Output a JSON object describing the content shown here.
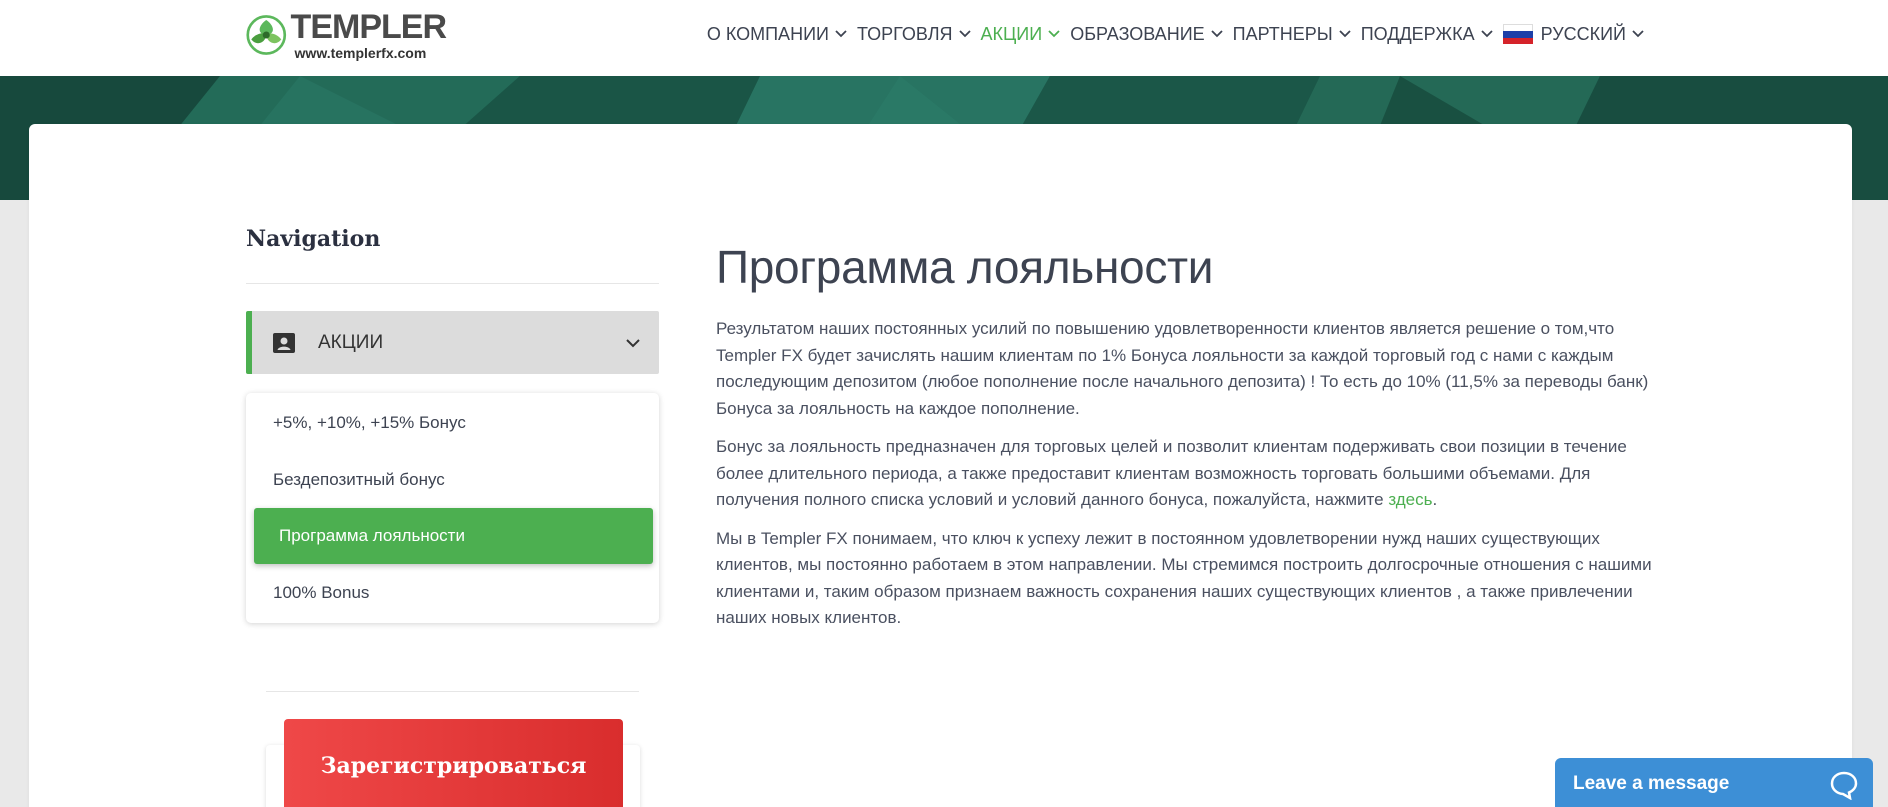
{
  "header": {
    "logo_name": "TEMPLER",
    "logo_url": "www.templerfx.com",
    "nav": [
      {
        "label": "О КОМПАНИИ",
        "active": false
      },
      {
        "label": "ТОРГОВЛЯ",
        "active": false
      },
      {
        "label": "АКЦИИ",
        "active": true
      },
      {
        "label": "ОБРАЗОВАНИЕ",
        "active": false
      },
      {
        "label": "ПАРТНЕРЫ",
        "active": false
      },
      {
        "label": "ПОДДЕРЖКА",
        "active": false
      }
    ],
    "language": "РУССКИЙ"
  },
  "sidebar": {
    "title": "Navigation",
    "accordion_label": "АКЦИИ",
    "items": [
      {
        "label": "+5%, +10%, +15% Бонус"
      },
      {
        "label": "Бездепозитный бонус"
      },
      {
        "label": "Программа лояльности"
      },
      {
        "label": "100% Bonus"
      }
    ],
    "register_label": "Зарегистрироваться"
  },
  "main": {
    "title": "Программа лояльности",
    "paragraphs": [
      "Результатом наших постоянных усилий по повышению удовлетворенности клиентов является решение о том,что Templer FX будет зачислять нашим клиентам по 1% Бонуса лояльности за каждой торговый год с нами с каждым последующим депозитом (любое пополнение после начального депозита) ! То есть до 10% (11,5% за переводы банк) Бонуса за лояльность на каждое пополнение.",
      "Бонус за лояльность предназначен для торговых целей и позволит клиентам подерживать свои позиции в течение более длительного периода, а также предоставит клиентам возможность торговать большими объемами. Для получения полного списка условий и условий данного бонуса, пожалуйста, нажмите",
      "Мы в Templer FX понимаем, что ключ к успеху лежит в постоянном удовлетворении нужд наших существующих клиентов, мы постоянно работаем в этом направлении. Мы стремимся построить долгосрочные отношения с нашими клиентами и, таким образом признаем важность сохранения наших существующих клиентов , а также привлечении наших новых клиентов."
    ],
    "link_label": "здесь",
    "after_link": "."
  },
  "chat": {
    "label": "Leave a message"
  },
  "colors": {
    "accent": "#4caf50",
    "register": "#e03a3a",
    "chat": "#3d8fd6",
    "banner": "#1c5a4b"
  }
}
